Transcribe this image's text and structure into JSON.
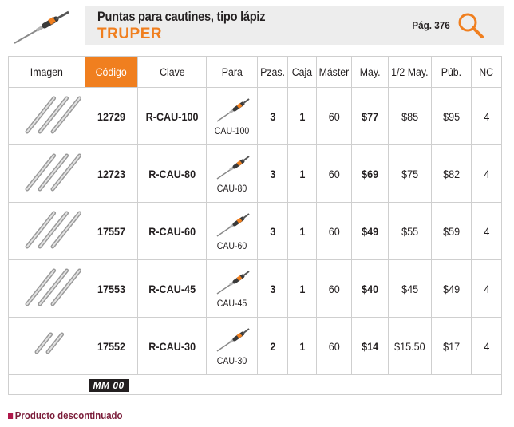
{
  "header": {
    "title": "Puntas para cautines, tipo lápiz",
    "brand": "TRUPER",
    "page_label": "Pág. 376",
    "search_icon": "search-icon",
    "accent_color": "#f07f1f"
  },
  "table": {
    "columns": [
      "Imagen",
      "Código",
      "Clave",
      "Para",
      "Pzas.",
      "Caja",
      "Máster",
      "May.",
      "1/2 May.",
      "Púb.",
      "NC"
    ],
    "highlight_column": "Código",
    "rows": [
      {
        "tip_count": 3,
        "codigo": "12729",
        "clave": "R-CAU-100",
        "para": "CAU-100",
        "pzas": "3",
        "caja": "1",
        "master": "60",
        "may": "$77",
        "half_may": "$85",
        "pub": "$95",
        "nc": "4"
      },
      {
        "tip_count": 3,
        "codigo": "12723",
        "clave": "R-CAU-80",
        "para": "CAU-80",
        "pzas": "3",
        "caja": "1",
        "master": "60",
        "may": "$69",
        "half_may": "$75",
        "pub": "$82",
        "nc": "4"
      },
      {
        "tip_count": 3,
        "codigo": "17557",
        "clave": "R-CAU-60",
        "para": "CAU-60",
        "pzas": "3",
        "caja": "1",
        "master": "60",
        "may": "$49",
        "half_may": "$55",
        "pub": "$59",
        "nc": "4"
      },
      {
        "tip_count": 3,
        "codigo": "17553",
        "clave": "R-CAU-45",
        "para": "CAU-45",
        "pzas": "3",
        "caja": "1",
        "master": "60",
        "may": "$40",
        "half_may": "$45",
        "pub": "$49",
        "nc": "4"
      },
      {
        "tip_count": 2,
        "codigo": "17552",
        "clave": "R-CAU-30",
        "para": "CAU-30",
        "pzas": "2",
        "caja": "1",
        "master": "60",
        "may": "$14",
        "half_may": "$15.50",
        "pub": "$17",
        "nc": "4"
      }
    ],
    "footer_badge": "MM 00"
  },
  "legend": {
    "discontinued": "Producto descontinuado",
    "discontinued_color": "#b0174a"
  }
}
